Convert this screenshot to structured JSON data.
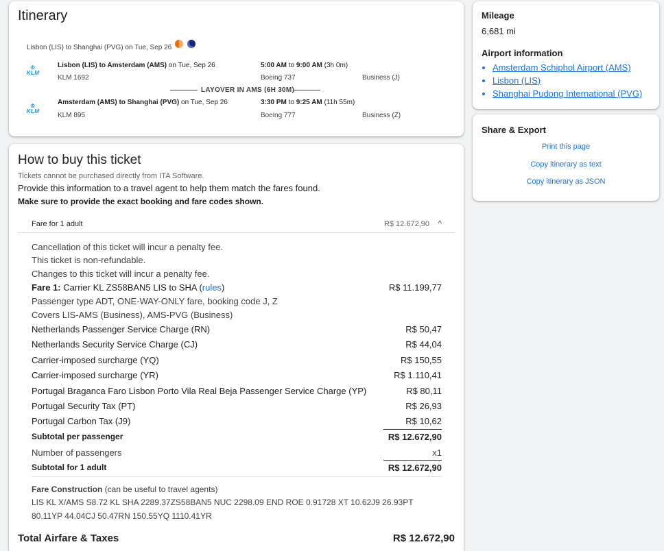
{
  "itinerary": {
    "title": "Itinerary",
    "route_summary": "Lisbon (LIS) to Shanghai (PVG) on Tue, Sep 26",
    "segments": [
      {
        "airline_logo": "KLM",
        "route": "Lisbon (LIS) to Amsterdam (AMS)",
        "date": " on Tue, Sep 26",
        "flight": "KLM 1692",
        "depart": "5:00 AM",
        "to": " to ",
        "arrive": "9:00 AM",
        "duration": " (3h 0m)",
        "aircraft": "Boeing 737",
        "cabin": "Business (J)"
      },
      {
        "airline_logo": "KLM",
        "route": "Amsterdam (AMS) to Shanghai (PVG)",
        "date": " on Tue, Sep 26",
        "flight": "KLM 895",
        "depart": "3:30 PM",
        "to": " to ",
        "arrive": "9:25 AM",
        "duration": " (11h 55m)",
        "aircraft": "Boeing 777",
        "cabin": "Business (Z)"
      }
    ],
    "layover": "LAYOVER IN AMS (6H 30M)"
  },
  "buy": {
    "title": "How to buy this ticket",
    "note": "Tickets cannot be purchased directly from ITA Software.",
    "info": "Provide this information to a travel agent to help them match the fares found.",
    "warning": "Make sure to provide the exact booking and fare codes shown.",
    "fare_header": {
      "label": "Fare for 1 adult",
      "amount": "R$ 12.672,90"
    },
    "penalties": [
      "Cancellation of this ticket will incur a penalty fee.",
      "This ticket is non-refundable.",
      "Changes to this ticket will incur a penalty fee."
    ],
    "fare1": {
      "label": "Fare 1:",
      "text": " Carrier KL ZS58BAN5 LIS to SHA (",
      "rules": "rules",
      "close": ")",
      "amount": "R$ 11.199,77",
      "detail1": "Passenger type ADT, ONE-WAY-ONLY fare, booking code J, Z",
      "detail2": "Covers LIS-AMS (Business), AMS-PVG (Business)"
    },
    "charges": [
      {
        "label": "Netherlands Passenger Service Charge (RN)",
        "amount": "R$ 50,47"
      },
      {
        "label": "Netherlands Security Service Charge (CJ)",
        "amount": "R$ 44,04"
      },
      {
        "label": "Carrier-imposed surcharge (YQ)",
        "amount": "R$ 150,55"
      },
      {
        "label": "Carrier-imposed surcharge (YR)",
        "amount": "R$ 1.110,41"
      },
      {
        "label": "Portugal Braganca Faro Lisbon Porto Vila Real Beja Passenger Service Charge (YP)",
        "amount": "R$ 80,11"
      },
      {
        "label": "Portugal Security Tax (PT)",
        "amount": "R$ 26,93"
      },
      {
        "label": "Portugal Carbon Tax (J9)",
        "amount": "R$ 10,62"
      }
    ],
    "subtotal_per_passenger": {
      "label": "Subtotal per passenger",
      "amount": "R$ 12.672,90"
    },
    "num_passengers": {
      "label": "Number of passengers",
      "value": "x1"
    },
    "subtotal_adult": {
      "label": "Subtotal for 1 adult",
      "amount": "R$ 12.672,90"
    },
    "fare_construction": {
      "label": "Fare Construction",
      "hint": " (can be useful to travel agents)",
      "line1": "LIS KL X/AMS S8.72 KL SHA 2289.37ZS58BAN5 NUC 2298.09 END ROE 0.91728 XT 10.62J9 26.93PT",
      "line2": "80.11YP 44.04CJ 50.47RN 150.55YQ 1110.41YR"
    },
    "total": {
      "label": "Total Airfare & Taxes",
      "amount": "R$ 12.672,90"
    }
  },
  "sidebar": {
    "mileage_title": "Mileage",
    "mileage_value": "6,681 mi",
    "airport_title": "Airport information",
    "airports": [
      "Amsterdam Schiphol Airport (AMS)",
      "Lisbon (LIS)",
      "Shanghai Pudong International (PVG)"
    ],
    "share_title": "Share & Export",
    "share_links": [
      "Print this page",
      "Copy itinerary as text",
      "Copy itinerary as JSON"
    ]
  },
  "colors": {
    "link": "#1a73e8",
    "klm_blue": "#00a1de",
    "bg": "#f1f3f4"
  }
}
